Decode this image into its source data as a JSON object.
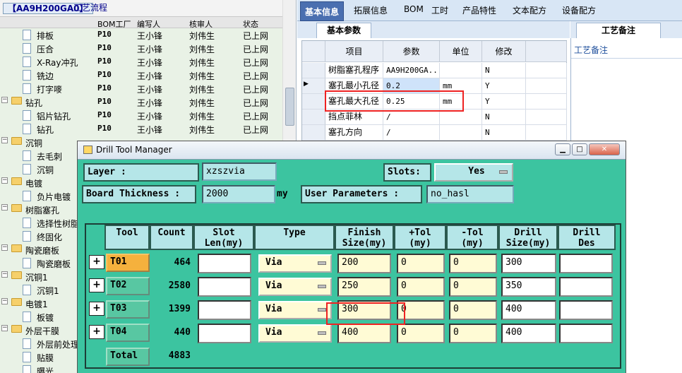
{
  "left_panel": {
    "title_code": "【AA9H200GA0】",
    "title_label": "工艺流程",
    "columns": [
      "BOM工厂",
      "编写人",
      "核审人",
      "状态"
    ],
    "rows": [
      {
        "type": "doc",
        "indent": 1,
        "name": "排板",
        "factory": "P10",
        "author": "王小锋",
        "reviewer": "刘伟生",
        "status": "已上网"
      },
      {
        "type": "doc",
        "indent": 1,
        "name": "压合",
        "factory": "P10",
        "author": "王小锋",
        "reviewer": "刘伟生",
        "status": "已上网"
      },
      {
        "type": "doc",
        "indent": 1,
        "name": "X-Ray冲孔",
        "factory": "P10",
        "author": "王小锋",
        "reviewer": "刘伟生",
        "status": "已上网"
      },
      {
        "type": "doc",
        "indent": 1,
        "name": "铣边",
        "factory": "P10",
        "author": "王小锋",
        "reviewer": "刘伟生",
        "status": "已上网"
      },
      {
        "type": "doc",
        "indent": 1,
        "name": "打字嘜",
        "factory": "P10",
        "author": "王小锋",
        "reviewer": "刘伟生",
        "status": "已上网"
      },
      {
        "type": "folder",
        "indent": 0,
        "name": "钻孔",
        "factory": "P10",
        "author": "王小锋",
        "reviewer": "刘伟生",
        "status": "已上网"
      },
      {
        "type": "doc",
        "indent": 1,
        "name": "铝片钻孔",
        "factory": "P10",
        "author": "王小锋",
        "reviewer": "刘伟生",
        "status": "已上网"
      },
      {
        "type": "doc",
        "indent": 1,
        "name": "钻孔",
        "factory": "P10",
        "author": "王小锋",
        "reviewer": "刘伟生",
        "status": "已上网"
      },
      {
        "type": "folder",
        "indent": 0,
        "name": "沉铜",
        "factory": "",
        "author": "",
        "reviewer": "",
        "status": ""
      },
      {
        "type": "doc",
        "indent": 1,
        "name": "去毛刺",
        "factory": "",
        "author": "",
        "reviewer": "",
        "status": ""
      },
      {
        "type": "doc",
        "indent": 1,
        "name": "沉铜",
        "factory": "",
        "author": "",
        "reviewer": "",
        "status": ""
      },
      {
        "type": "folder",
        "indent": 0,
        "name": "电镀",
        "factory": "",
        "author": "",
        "reviewer": "",
        "status": ""
      },
      {
        "type": "doc",
        "indent": 1,
        "name": "负片电镀",
        "factory": "",
        "author": "",
        "reviewer": "",
        "status": ""
      },
      {
        "type": "folder",
        "indent": 0,
        "name": "树脂塞孔",
        "factory": "",
        "author": "",
        "reviewer": "",
        "status": ""
      },
      {
        "type": "doc",
        "indent": 1,
        "name": "选择性树脂",
        "factory": "",
        "author": "",
        "reviewer": "",
        "status": ""
      },
      {
        "type": "doc",
        "indent": 1,
        "name": "终固化",
        "factory": "",
        "author": "",
        "reviewer": "",
        "status": ""
      },
      {
        "type": "folder",
        "indent": 0,
        "name": "陶瓷磨板",
        "factory": "",
        "author": "",
        "reviewer": "",
        "status": ""
      },
      {
        "type": "doc",
        "indent": 1,
        "name": "陶瓷磨板",
        "factory": "",
        "author": "",
        "reviewer": "",
        "status": ""
      },
      {
        "type": "folder",
        "indent": 0,
        "name": "沉铜1",
        "factory": "",
        "author": "",
        "reviewer": "",
        "status": ""
      },
      {
        "type": "doc",
        "indent": 1,
        "name": "沉铜1",
        "factory": "",
        "author": "",
        "reviewer": "",
        "status": ""
      },
      {
        "type": "folder",
        "indent": 0,
        "name": "电镀1",
        "factory": "",
        "author": "",
        "reviewer": "",
        "status": ""
      },
      {
        "type": "doc",
        "indent": 1,
        "name": "板镀",
        "factory": "",
        "author": "",
        "reviewer": "",
        "status": ""
      },
      {
        "type": "folder",
        "indent": 0,
        "name": "外层干膜",
        "factory": "",
        "author": "",
        "reviewer": "",
        "status": ""
      },
      {
        "type": "doc",
        "indent": 1,
        "name": "外层前处理",
        "factory": "",
        "author": "",
        "reviewer": "",
        "status": ""
      },
      {
        "type": "doc",
        "indent": 1,
        "name": "贴膜",
        "factory": "",
        "author": "",
        "reviewer": "",
        "status": ""
      },
      {
        "type": "doc",
        "indent": 1,
        "name": "曝光",
        "factory": "",
        "author": "",
        "reviewer": "",
        "status": ""
      }
    ]
  },
  "top_tabs": [
    "基本信息",
    "拓展信息",
    "BOM",
    "工时",
    "产品特性",
    "文本配方",
    "设备配方"
  ],
  "basic_tab": "基本参数",
  "process_notes_tab": "工艺备注",
  "process_notes_label": "工艺备注",
  "param_grid": {
    "headers": [
      "项目",
      "参数",
      "单位",
      "修改"
    ],
    "rows": [
      {
        "item": "树脂塞孔程序",
        "value": "AA9H200GA...",
        "unit": "",
        "mod": "N",
        "current": false
      },
      {
        "item": "塞孔最小孔径",
        "value": "0.2",
        "unit": "mm",
        "mod": "Y",
        "current": true
      },
      {
        "item": "塞孔最大孔径",
        "value": "0.25",
        "unit": "mm",
        "mod": "Y",
        "current": false
      },
      {
        "item": "挡点菲林",
        "value": "/",
        "unit": "",
        "mod": "N",
        "current": false
      },
      {
        "item": "塞孔方向",
        "value": "/",
        "unit": "",
        "mod": "N",
        "current": false
      }
    ]
  },
  "dialog": {
    "title": "Drill Tool Manager",
    "layer_label": "Layer         :",
    "layer_value": "xzszvia",
    "slots_label": "Slots:",
    "slots_value": "Yes",
    "thickness_label": "Board Thickness :",
    "thickness_value": "2000",
    "thickness_unit": "my",
    "user_params_label": "User Parameters :",
    "user_params_value": "no_hasl",
    "headers": {
      "tool": "Tool",
      "count": "Count",
      "slot_len": "Slot\nLen(my)",
      "type": "Type",
      "finish": "Finish\nSize(my)",
      "ptol": "+Tol\n(my)",
      "ntol": "-Tol\n(my)",
      "drill_size": "Drill\nSize(my)",
      "drill_des": "Drill\nDes"
    },
    "tools": [
      {
        "name": "T01",
        "count": "464",
        "slot_len": "",
        "type": "Via",
        "finish": "200",
        "ptol": "0",
        "ntol": "0",
        "drill": "300",
        "des": "",
        "selected": true
      },
      {
        "name": "T02",
        "count": "2580",
        "slot_len": "",
        "type": "Via",
        "finish": "250",
        "ptol": "0",
        "ntol": "0",
        "drill": "350",
        "des": "",
        "selected": false
      },
      {
        "name": "T03",
        "count": "1399",
        "slot_len": "",
        "type": "Via",
        "finish": "300",
        "ptol": "0",
        "ntol": "0",
        "drill": "400",
        "des": "",
        "selected": false
      },
      {
        "name": "T04",
        "count": "440",
        "slot_len": "",
        "type": "Via",
        "finish": "400",
        "ptol": "0",
        "ntol": "0",
        "drill": "400",
        "des": "",
        "selected": false
      }
    ],
    "total_label": "Total",
    "total_count": "4883"
  },
  "colors": {
    "dialog_bg": "#3cc4a0",
    "selected_tool": "#f5b13d",
    "highlight_box": "#e22222",
    "tab_active": "#4a6fb0"
  }
}
